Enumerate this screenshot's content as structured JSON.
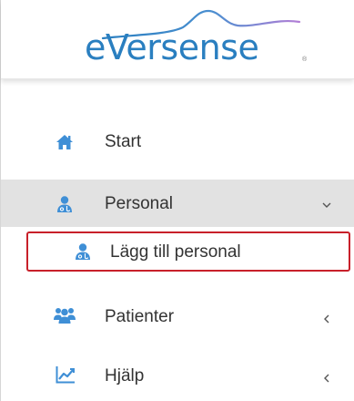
{
  "brand": {
    "logo_text": "eVersense",
    "registered_mark": "®"
  },
  "colors": {
    "brand_blue": "#2a7fc0",
    "icon_blue": "#3f8fd6",
    "active_bg": "#e2e2e2",
    "highlight_border": "#c8202a",
    "text": "#333333"
  },
  "sidebar": {
    "items": [
      {
        "label": "Start",
        "icon": "home-icon",
        "expanded": null
      },
      {
        "label": "Personal",
        "icon": "staff-icon",
        "expanded": true,
        "chevron": "chevron-down-icon"
      },
      {
        "label": "Patienter",
        "icon": "patients-icon",
        "expanded": false,
        "chevron": "chevron-left-icon"
      },
      {
        "label": "Hjälp",
        "icon": "chart-line-icon",
        "expanded": false,
        "chevron": "chevron-left-icon"
      }
    ],
    "subitems": [
      {
        "label": "Lägg till personal",
        "icon": "staff-icon",
        "highlighted": true
      }
    ]
  }
}
